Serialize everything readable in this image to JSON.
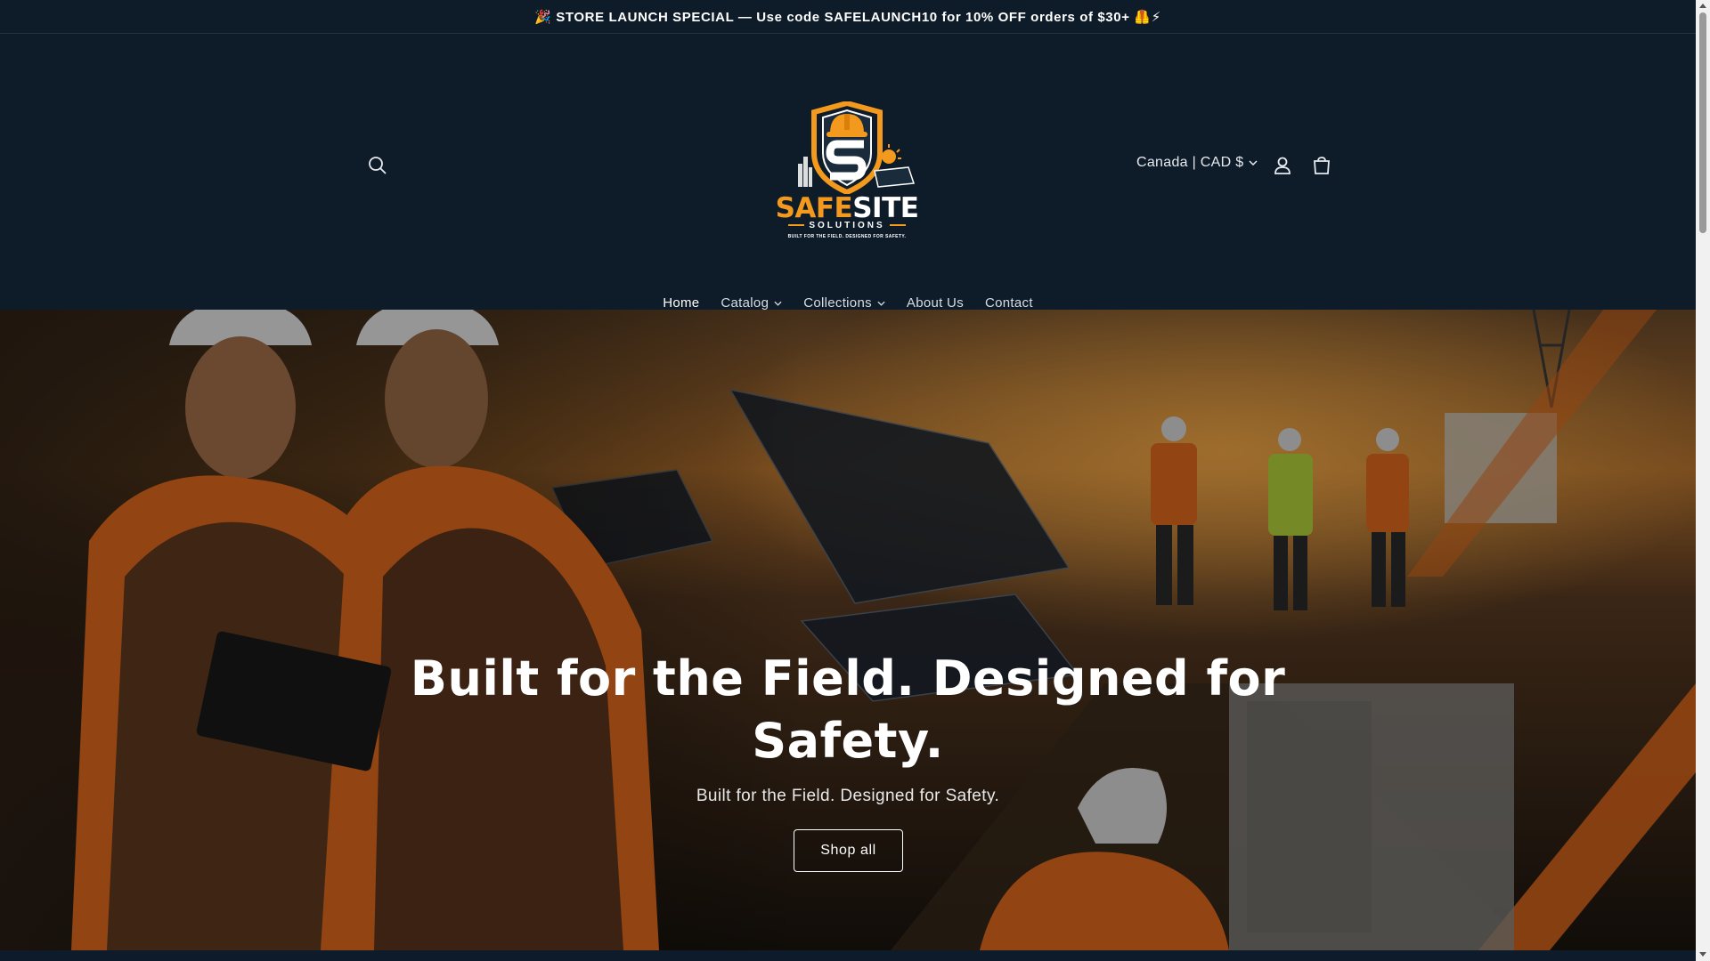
{
  "announcement": {
    "text": "🎉 STORE LAUNCH SPECIAL — Use code SAFELAUNCH10 for 10% OFF orders of $30+ 🦺⚡"
  },
  "header": {
    "currency": "Canada | CAD $",
    "logo": {
      "title_orange": "SAFE",
      "title_white": "SITE",
      "subtitle": "SOLUTIONS",
      "tagline": "BUILT FOR THE FIELD. DESIGNED FOR SAFETY."
    },
    "icons": {
      "search": "search-icon",
      "account": "account-icon",
      "cart": "cart-icon"
    }
  },
  "nav": {
    "items": [
      {
        "label": "Home"
      },
      {
        "label": "Catalog"
      },
      {
        "label": "Collections"
      },
      {
        "label": "About Us"
      },
      {
        "label": "Contact"
      }
    ]
  },
  "hero": {
    "title": "Built for the Field. Designed for Safety.",
    "subtitle": "Built for the Field. Designed for Safety.",
    "button": "Shop all"
  },
  "colors": {
    "background": "#0e1b29",
    "accent": "#f39a1e"
  }
}
